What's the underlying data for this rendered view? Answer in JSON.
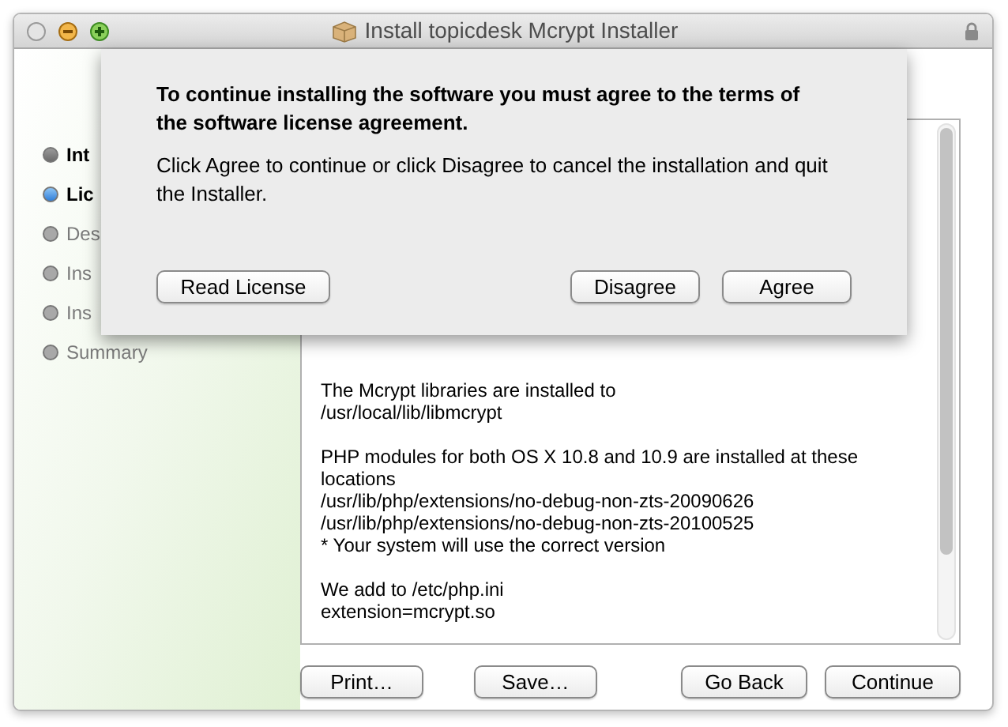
{
  "window": {
    "title": "Install topicdesk Mcrypt Installer"
  },
  "sidebar": {
    "items": [
      {
        "label": "Int",
        "selected": false,
        "completed": true
      },
      {
        "label": "Lic",
        "selected": true,
        "completed": false
      },
      {
        "label": "Des",
        "selected": false,
        "completed": false
      },
      {
        "label": "Ins",
        "selected": false,
        "completed": false
      },
      {
        "label": "Ins",
        "selected": false,
        "completed": false
      },
      {
        "label": "Summary",
        "selected": false,
        "completed": false
      }
    ]
  },
  "content": {
    "paragraphs": [
      [
        "The Mcrypt libraries are installed to",
        "/usr/local/lib/libmcrypt"
      ],
      [
        "PHP modules for both OS X 10.8 and 10.9 are installed at these locations",
        "/usr/lib/php/extensions/no-debug-non-zts-20090626",
        "/usr/lib/php/extensions/no-debug-non-zts-20100525",
        "* Your system will use the correct version"
      ],
      [
        "We add to /etc/php.ini",
        "extension=mcrypt.so"
      ]
    ]
  },
  "buttons": {
    "left": [
      "Print…",
      "Save…"
    ],
    "right": [
      "Go Back",
      "Continue"
    ]
  },
  "sheet": {
    "heading": "To continue installing the software you must agree to the terms of the software license agreement.",
    "message": "Click Agree to continue or click Disagree to cancel the installation and quit the Installer.",
    "left_button": "Read License",
    "right_buttons": [
      "Disagree",
      "Agree"
    ]
  }
}
